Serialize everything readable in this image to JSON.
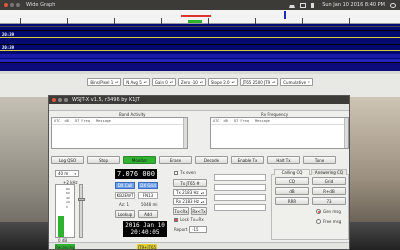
{
  "topbar": {
    "window_title": "Wide Graph",
    "clock": "Sun Jan 10 2016 8:40 PM"
  },
  "wide_graph": {
    "timestamps": [
      "20:39",
      "20:39"
    ],
    "controls": [
      "Bins/Pixel 1",
      "N Avg 5",
      "Gain 0",
      "Zero -10",
      "Slope 2.0",
      "JT65 2500 JT9",
      "Cumulative"
    ]
  },
  "wsjt": {
    "title": "WSJT-X v1.5, r3496 by K1JT",
    "band_activity": "Band Activity",
    "rx_frequency": "Rx Frequency",
    "header_left": "UTC  dB   DT Freq   Message",
    "header_right": "UTC  dB   DT Freq   Message",
    "buttons": {
      "log_qso": "Log QSO",
      "stop": "Stop",
      "monitor": "Monitor",
      "erase": "Erase",
      "decode": "Decode",
      "enable_tx": "Enable Tx",
      "halt_tx": "Halt Tx",
      "tune": "Tune"
    },
    "band": "40 m",
    "frequency": "7.076 000",
    "tx_even": "Tx even",
    "tx_jt65_label": "Tx JT65 #",
    "offset_label": "+2 kHz",
    "dx_call_label": "DX Call",
    "dx_grid_label": "DX Grid",
    "dx_call": "KB2EWT",
    "dx_grid": "FN13",
    "az_label": "Az: 1",
    "distance": "5048 mi",
    "lookup": "Lookup",
    "add": "Add",
    "tx_hz": "Tx 2183 Hz",
    "rx_hz": "Rx 2183 Hz",
    "tx_rx": "Tx<Rx",
    "rx_tx": "Rx<Tx",
    "lock": "Lock Tx=Rx",
    "report_label": "Report",
    "report": "-15",
    "date": "2016 Jan 10",
    "time": "20:40:05",
    "meter_label": "0 dB",
    "tabs": [
      "Calling CQ",
      "Answering CQ"
    ],
    "macros": [
      "CQ",
      "Grid",
      "dB",
      "R+dB",
      "RRR",
      "73"
    ],
    "gen_msg": "Gen msg",
    "free_msg": "Free msg",
    "status_mode": "Receiving",
    "status_jt": "JT9+JT65",
    "meter_level_pct": 40,
    "slider_level_pct": 75
  }
}
